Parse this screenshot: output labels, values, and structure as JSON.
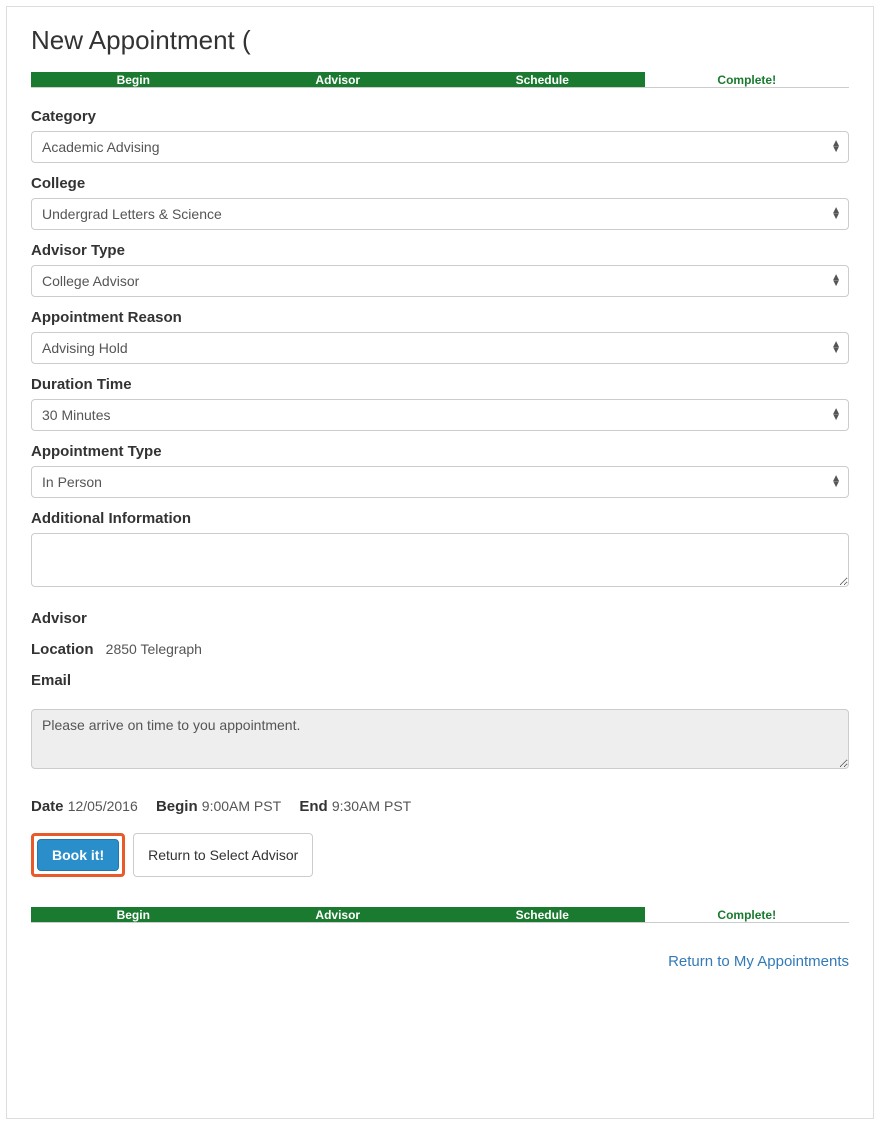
{
  "page_title": "New Appointment (",
  "progress": {
    "steps": [
      {
        "label": "Begin",
        "state": "done"
      },
      {
        "label": "Advisor",
        "state": "done"
      },
      {
        "label": "Schedule",
        "state": "done"
      },
      {
        "label": "Complete!",
        "state": "pending"
      }
    ]
  },
  "form": {
    "category": {
      "label": "Category",
      "value": "Academic Advising"
    },
    "college": {
      "label": "College",
      "value": "Undergrad Letters & Science"
    },
    "advisor_type": {
      "label": "Advisor Type",
      "value": "College Advisor"
    },
    "reason": {
      "label": "Appointment Reason",
      "value": "Advising Hold"
    },
    "duration": {
      "label": "Duration Time",
      "value": "30 Minutes"
    },
    "appt_type": {
      "label": "Appointment Type",
      "value": "In Person"
    },
    "additional": {
      "label": "Additional Information",
      "value": ""
    }
  },
  "advisor_info": {
    "advisor_label": "Advisor",
    "advisor_value": "",
    "location_label": "Location",
    "location_value": "2850 Telegraph",
    "email_label": "Email",
    "email_value": ""
  },
  "note_text": "Please arrive on time to you appointment.",
  "datetime": {
    "date_label": "Date",
    "date_value": "12/05/2016",
    "begin_label": "Begin",
    "begin_value": "9:00AM PST",
    "end_label": "End",
    "end_value": "9:30AM PST"
  },
  "actions": {
    "book_label": "Book it!",
    "return_advisor_label": "Return to Select Advisor"
  },
  "return_link": "Return to My Appointments"
}
